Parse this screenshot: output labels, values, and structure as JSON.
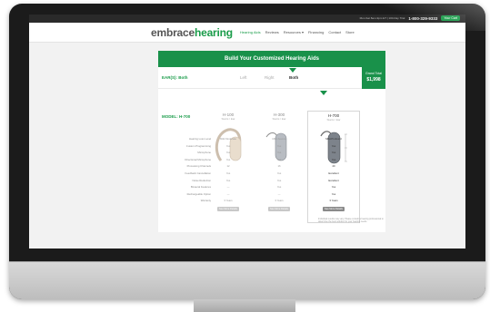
{
  "topbar": {
    "tiny_links": "Mon-Sat 8am-9pm ET | 100-Day Trial",
    "phone": "1-800-329-9333",
    "cart_label": "Your Cart"
  },
  "header": {
    "logo_a": "embrace",
    "logo_b": "hearing",
    "nav": [
      "Hearing Aids",
      "Reviews",
      "Resources ▾",
      "Financing",
      "Contact",
      "Store"
    ]
  },
  "builder": {
    "title": "Build Your Customized Hearing Aids",
    "ears_label": "EAR(S): Both",
    "ear_options": [
      "Left",
      "Right",
      "Both"
    ],
    "total_label": "Grand Total",
    "total_value": "$1,998",
    "model_label": "MODEL: H-700",
    "models": [
      {
        "name": "H-100",
        "price": "Starts / Ear"
      },
      {
        "name": "H-300",
        "price": "Starts / Ear"
      },
      {
        "name": "H-700",
        "price": "Starts / Ear"
      }
    ],
    "spec_rows": [
      "Hearing Loss Level",
      "Custom Programming",
      "Microphone",
      "Directional Microphone",
      "Processing Channels",
      "Feedback Cancellation",
      "Noise Reduction",
      "Binaural Features",
      "Rechargeable Option",
      "Warranty"
    ],
    "col1_values": [
      "Mild-Moderate",
      "Yes",
      "Yes",
      "Yes",
      "12",
      "Yes",
      "Yes",
      "—",
      "—",
      "3 Years"
    ],
    "col2_values": [
      "Mild-Severe",
      "Yes",
      "Yes",
      "Yes",
      "16",
      "Yes",
      "Yes",
      "Yes",
      "—",
      "3 Years"
    ],
    "col3_values": [
      "Mild-Profound",
      "Yes",
      "Yes",
      "Yes",
      "20",
      "Excellent",
      "Excellent",
      "Yes",
      "Yes",
      "3 Years"
    ],
    "button_label": "See More Details",
    "note": "Individual results may vary. Please consult a hearing professional to determine the best solution for your hearing needs."
  },
  "colors": {
    "brand": "#19914a",
    "frame": "#1b1b1b"
  }
}
